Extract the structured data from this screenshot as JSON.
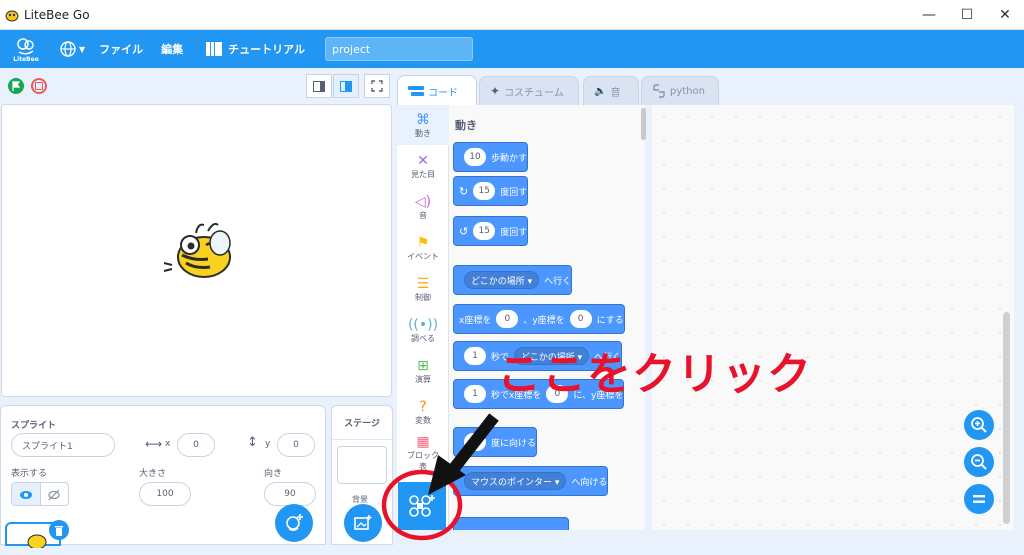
{
  "window": {
    "title": "LiteBee Go",
    "controls": [
      "—",
      "☐",
      "✕"
    ]
  },
  "menubar": {
    "logo_text": "LiteBee",
    "file": "ファイル",
    "edit": "編集",
    "tutorial": "チュートリアル",
    "project_name": "project"
  },
  "tabs": {
    "code": "コード",
    "costume": "コスチューム",
    "sound": "音",
    "python": "python"
  },
  "categories": [
    {
      "label": "動き",
      "icon": "motion-icon",
      "color": "#4c97ff"
    },
    {
      "label": "見た目",
      "icon": "looks-icon",
      "color": "#9966ff"
    },
    {
      "label": "音",
      "icon": "sound-icon",
      "color": "#cf63cf"
    },
    {
      "label": "イベント",
      "icon": "event-icon",
      "color": "#ffbf00"
    },
    {
      "label": "制御",
      "icon": "control-icon",
      "color": "#ffab19"
    },
    {
      "label": "調べる",
      "icon": "sensing-icon",
      "color": "#5cb1d6"
    },
    {
      "label": "演算",
      "icon": "operators-icon",
      "color": "#59c059"
    },
    {
      "label": "変数",
      "icon": "variables-icon",
      "color": "#ff8c1a"
    },
    {
      "label": "ブロック",
      "icon": "myblocks-icon",
      "color": "#ff6680"
    },
    {
      "label": "表",
      "icon": "list-icon",
      "color": "#ff661a"
    }
  ],
  "palette": {
    "category_title": "動き",
    "blocks": [
      {
        "pre": "",
        "num": "10",
        "post": "歩動かす"
      },
      {
        "pre": "↻",
        "num": "15",
        "post": "度回す"
      },
      {
        "pre": "↺",
        "num": "15",
        "post": "度回す"
      },
      {
        "drop": "どこかの場所 ▾",
        "post": "へ行く"
      },
      {
        "pre": "x座標を",
        "num": "0",
        "mid": "、y座標を",
        "num2": "0",
        "post": "にする"
      },
      {
        "num": "1",
        "pre2": "秒で",
        "drop": "どこかの場所 ▾",
        "post": "へ行く"
      },
      {
        "num": "1",
        "pre2": "秒でx座標を",
        "num2": "0",
        "post": "に、y座標を"
      },
      {
        "num": "90",
        "post": "度に向ける"
      },
      {
        "drop": "マウスのポインター ▾",
        "post": "へ向ける"
      }
    ]
  },
  "sprite_panel": {
    "header": "スプライト",
    "name": "スプライト1",
    "x_label": "x",
    "x_value": "0",
    "y_label": "y",
    "y_value": "0",
    "show_label": "表示する",
    "size_label": "大きさ",
    "size_value": "100",
    "direction_label": "向き",
    "direction_value": "90"
  },
  "stage_panel": {
    "header": "ステージ",
    "backdrop_label": "背景"
  },
  "annotation": {
    "text": "ここをクリック",
    "color": "#e8132a"
  },
  "colors": {
    "accent": "#2196f3",
    "motion": "#4c97ff"
  }
}
